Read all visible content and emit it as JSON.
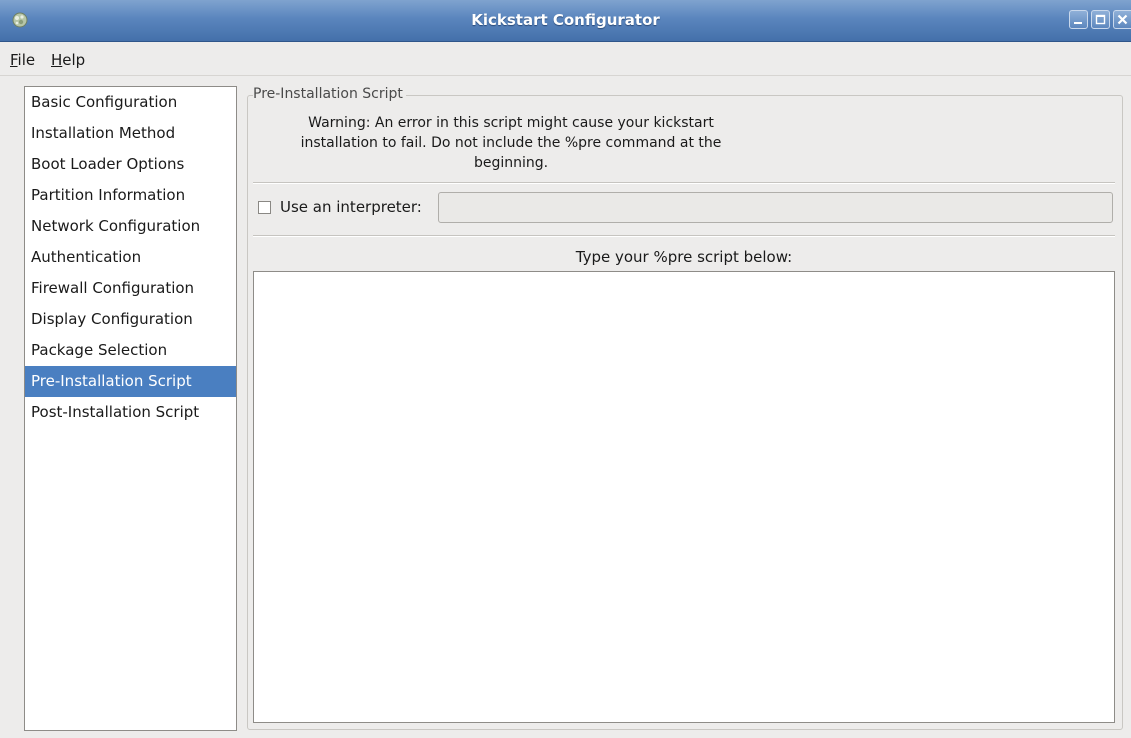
{
  "window": {
    "title": "Kickstart Configurator"
  },
  "menu": {
    "file_mnemonic": "F",
    "file_rest": "ile",
    "help_mnemonic": "H",
    "help_rest": "elp"
  },
  "sidebar": {
    "selected_index": 9,
    "items": [
      {
        "label": "Basic Configuration"
      },
      {
        "label": "Installation Method"
      },
      {
        "label": "Boot Loader Options"
      },
      {
        "label": "Partition Information"
      },
      {
        "label": "Network Configuration"
      },
      {
        "label": "Authentication"
      },
      {
        "label": "Firewall Configuration"
      },
      {
        "label": "Display Configuration"
      },
      {
        "label": "Package Selection"
      },
      {
        "label": "Pre-Installation Script"
      },
      {
        "label": "Post-Installation Script"
      }
    ]
  },
  "panel": {
    "frame_title": "Pre-Installation Script",
    "warning_line1": "Warning: An error in this script might cause your kickstart",
    "warning_line2": "installation to fail. Do not include the %pre command at the",
    "warning_line3": "beginning.",
    "interpreter_label": "Use an interpreter:",
    "interpreter_checked": false,
    "interpreter_value": "",
    "script_caption": "Type your %pre script below:",
    "script_value": ""
  },
  "colors": {
    "titlebar": "#5a85bd",
    "selection": "#4a7fc1",
    "window_bg": "#edeceb"
  },
  "icons": {
    "app": "kickstart-app-icon",
    "minimize": "minimize-icon",
    "maximize": "maximize-icon",
    "close": "close-icon"
  }
}
